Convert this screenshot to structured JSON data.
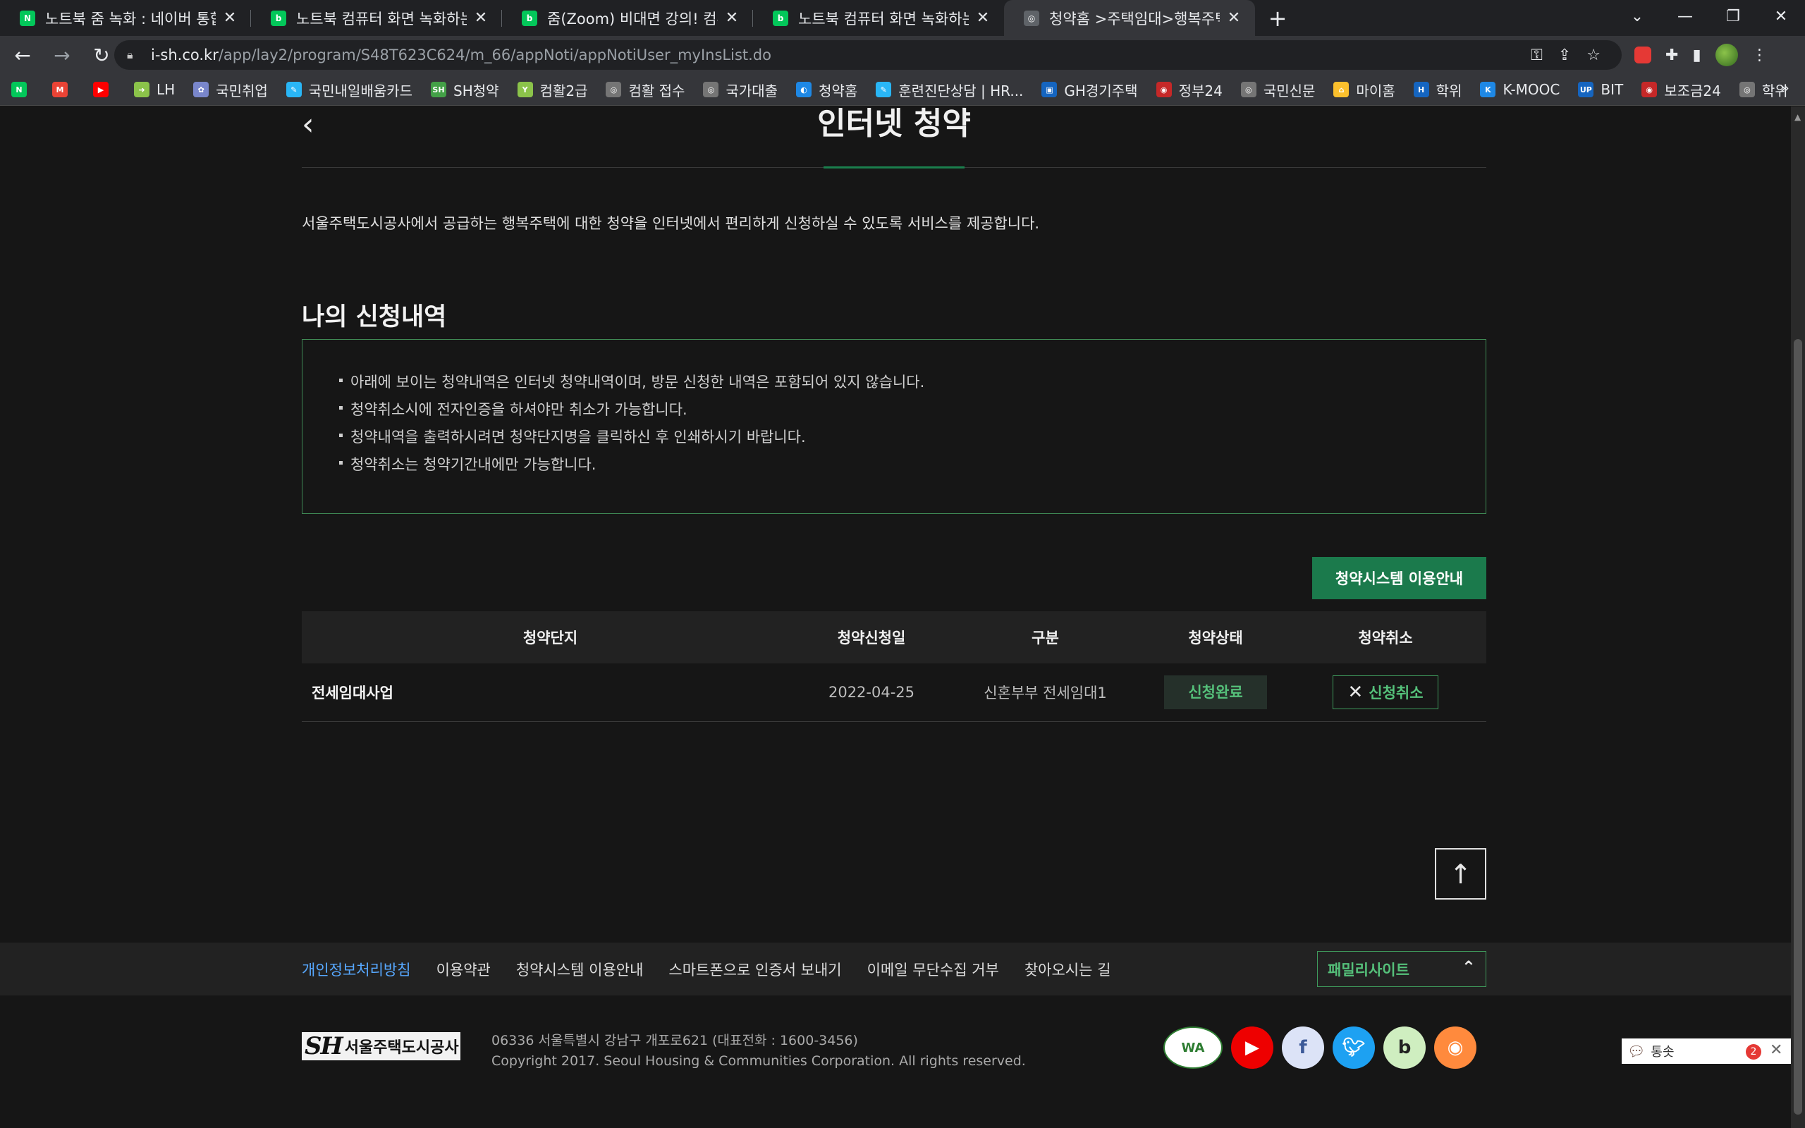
{
  "browser": {
    "tabs": [
      {
        "title": "노트북 줌 녹화 : 네이버 통합검색",
        "icon": "N",
        "color": "#03c75a",
        "active": false
      },
      {
        "title": "노트북 컴퓨터 화면 녹화하는 법",
        "icon": "blog",
        "color": "#03c75a",
        "active": false
      },
      {
        "title": "줌(Zoom) 비대면 강의! 컴퓨터 화",
        "icon": "blog",
        "color": "#03c75a",
        "active": false
      },
      {
        "title": "노트북 컴퓨터 화면 녹화하는 법",
        "icon": "blog",
        "color": "#03c75a",
        "active": false
      },
      {
        "title": "청약홈 >주택임대>행복주택>인터넷",
        "icon": "globe",
        "color": "#5f6368",
        "active": true
      }
    ],
    "url_host": "i-sh.co.kr",
    "url_path": "/app/lay2/program/S48T623C624/m_66/appNoti/appNotiUser_myInsList.do",
    "bookmarks": [
      {
        "label": "",
        "icon": "N",
        "color": "#03c75a"
      },
      {
        "label": "",
        "icon": "M",
        "color": "#ea4335"
      },
      {
        "label": "",
        "icon": "▶",
        "color": "#ff0000"
      },
      {
        "label": "LH",
        "icon": "➜",
        "color": "#8bc34a"
      },
      {
        "label": "국민취업",
        "icon": "✿",
        "color": "#7986cb"
      },
      {
        "label": "국민내일배움카드",
        "icon": "✎",
        "color": "#29b6f6"
      },
      {
        "label": "SH청약",
        "icon": "SH",
        "color": "#43a047"
      },
      {
        "label": "컴활2급",
        "icon": "Y",
        "color": "#8bc34a"
      },
      {
        "label": "컴활 접수",
        "icon": "◎",
        "color": "#757575"
      },
      {
        "label": "국가대출",
        "icon": "◎",
        "color": "#757575"
      },
      {
        "label": "청약홈",
        "icon": "◐",
        "color": "#1e88e5"
      },
      {
        "label": "훈련진단상담 | HR...",
        "icon": "✎",
        "color": "#29b6f6"
      },
      {
        "label": "GH경기주택",
        "icon": "▣",
        "color": "#1565c0"
      },
      {
        "label": "정부24",
        "icon": "◉",
        "color": "#c62828"
      },
      {
        "label": "국민신문",
        "icon": "◎",
        "color": "#757575"
      },
      {
        "label": "마이홈",
        "icon": "⌂",
        "color": "#fbc02d"
      },
      {
        "label": "학위",
        "icon": "H",
        "color": "#1565c0"
      },
      {
        "label": "K-MOOC",
        "icon": "K",
        "color": "#1e88e5"
      },
      {
        "label": "BIT",
        "icon": "UP",
        "color": "#1565c0"
      },
      {
        "label": "보조금24",
        "icon": "◉",
        "color": "#c62828"
      },
      {
        "label": "학위",
        "icon": "◎",
        "color": "#757575"
      }
    ]
  },
  "page": {
    "title": "인터넷 청약",
    "intro": "서울주택도시공사에서 공급하는 행복주택에 대한 청약을 인터넷에서 편리하게 신청하실 수 있도록 서비스를 제공합니다.",
    "section_title": "나의 신청내역",
    "notices": [
      "아래에 보이는 청약내역은 인터넷 청약내역이며, 방문 신청한 내역은 포함되어 있지 않습니다.",
      "청약취소시에 전자인증을 하셔야만 취소가 가능합니다.",
      "청약내역을 출력하시려면 청약단지명을 클릭하신 후 인쇄하시기 바랍니다.",
      "청약취소는 청약기간내에만 가능합니다."
    ],
    "guide_button": "청약시스템 이용안내",
    "table": {
      "headers": [
        "청약단지",
        "청약신청일",
        "구분",
        "청약상태",
        "청약취소"
      ],
      "rows": [
        {
          "complex": "전세임대사업",
          "date": "2022-04-25",
          "type": "신혼부부 전세임대1",
          "status": "신청완료",
          "cancel": "신청취소"
        }
      ]
    }
  },
  "footer": {
    "links": [
      "개인정보처리방침",
      "이용약관",
      "청약시스템 이용안내",
      "스마트폰으로 인증서 보내기",
      "이메일 무단수집 거부",
      "찾아오시는 길"
    ],
    "family_site": "패밀리사이트",
    "logo_text": "서울주택도시공사",
    "address": "06336 서울특별시 강남구 개포로621 (대표전화 : 1600-3456)",
    "copyright": "Copyright 2017. Seoul Housing & Communities Corporation. All rights reserved.",
    "social": [
      "wa-certification-icon",
      "youtube-icon",
      "facebook-icon",
      "twitter-icon",
      "blog-icon",
      "rss-icon"
    ]
  },
  "chat": {
    "label": "통솟",
    "count": "2"
  }
}
